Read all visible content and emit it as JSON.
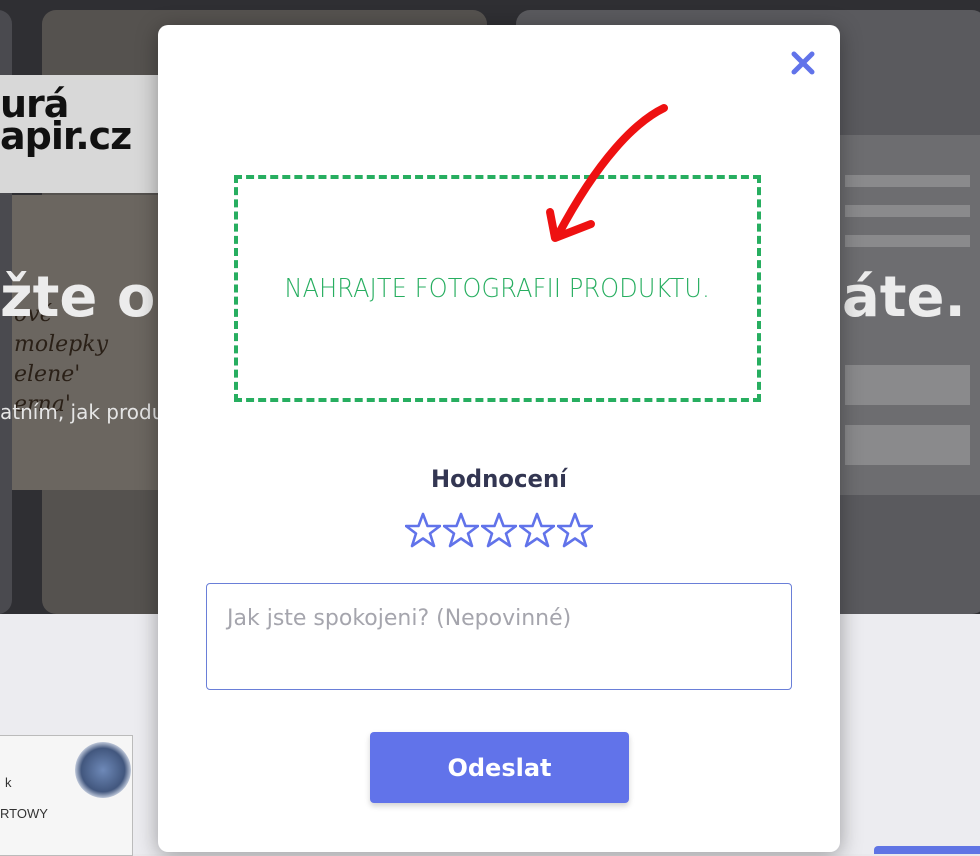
{
  "background": {
    "logo_line1": "urá",
    "logo_line2": "apir.cz",
    "headline_left": "žte ost",
    "headline_right": "áte.",
    "subline": "atním, jak produ",
    "product_words": [
      "ové",
      "molepky",
      "elene'",
      "erna'"
    ],
    "thumb_letter": "k",
    "thumb_text": "RTOWY"
  },
  "modal": {
    "close_icon": "close-icon",
    "upload_text": "NAHRAJTE FOTOGRAFII PRODUKTU.",
    "rating_title": "Hodnocení",
    "rating_value": 0,
    "rating_max": 5,
    "comment_placeholder": "Jak jste spokojeni? (Nepovinné)",
    "comment_value": "",
    "submit_label": "Odeslat"
  },
  "colors": {
    "accent": "#6173ea",
    "upload_green": "#27ae60",
    "arrow_red": "#ee1111",
    "title_dark": "#333652"
  }
}
